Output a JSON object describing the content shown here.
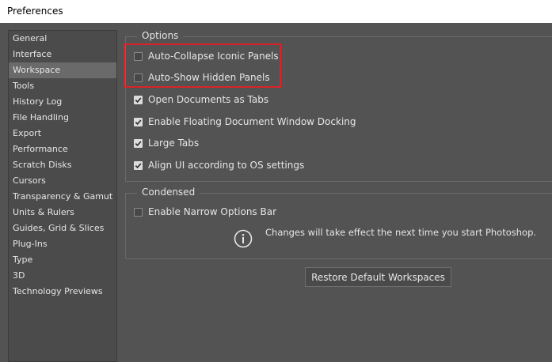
{
  "window": {
    "title": "Preferences"
  },
  "sidebar": {
    "items": [
      {
        "label": "General",
        "selected": false
      },
      {
        "label": "Interface",
        "selected": false
      },
      {
        "label": "Workspace",
        "selected": true
      },
      {
        "label": "Tools",
        "selected": false
      },
      {
        "label": "History Log",
        "selected": false
      },
      {
        "label": "File Handling",
        "selected": false
      },
      {
        "label": "Export",
        "selected": false
      },
      {
        "label": "Performance",
        "selected": false
      },
      {
        "label": "Scratch Disks",
        "selected": false
      },
      {
        "label": "Cursors",
        "selected": false
      },
      {
        "label": "Transparency & Gamut",
        "selected": false
      },
      {
        "label": "Units & Rulers",
        "selected": false
      },
      {
        "label": "Guides, Grid & Slices",
        "selected": false
      },
      {
        "label": "Plug-Ins",
        "selected": false
      },
      {
        "label": "Type",
        "selected": false
      },
      {
        "label": "3D",
        "selected": false
      },
      {
        "label": "Technology Previews",
        "selected": false
      }
    ]
  },
  "options": {
    "legend": "Options",
    "items": [
      {
        "label": "Auto-Collapse Iconic Panels",
        "checked": false
      },
      {
        "label": "Auto-Show Hidden Panels",
        "checked": false
      },
      {
        "label": "Open Documents as Tabs",
        "checked": true
      },
      {
        "label": "Enable Floating Document Window Docking",
        "checked": true
      },
      {
        "label": "Large Tabs",
        "checked": true
      },
      {
        "label": "Align UI according to OS settings",
        "checked": true
      }
    ]
  },
  "condensed": {
    "legend": "Condensed",
    "items": [
      {
        "label": "Enable Narrow Options Bar",
        "checked": false
      }
    ]
  },
  "info": {
    "icon": "info-icon",
    "text": "Changes will take effect the next time you start Photoshop."
  },
  "buttons": {
    "restore_label": "Restore Default Workspaces"
  },
  "colors": {
    "highlight": "#d9232a",
    "panel_bg": "#535353",
    "selected_bg": "#6a6a6a"
  }
}
